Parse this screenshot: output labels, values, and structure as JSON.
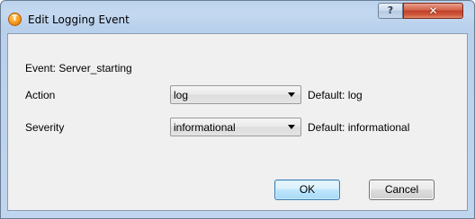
{
  "window": {
    "title": "Edit Logging Event",
    "app_icon_letter": "T",
    "help_symbol": "?",
    "close_symbol": "✕"
  },
  "event": {
    "label": "Event: Server_starting"
  },
  "action": {
    "label": "Action",
    "value": "log",
    "default_text": "Default: log"
  },
  "severity": {
    "label": "Severity",
    "value": "informational",
    "default_text": "Default: informational"
  },
  "buttons": {
    "ok": "OK",
    "cancel": "Cancel"
  },
  "colors": {
    "title_bar": "#bcd3ee",
    "close_button": "#c1402a",
    "default_button_border": "#3c7fb1"
  }
}
